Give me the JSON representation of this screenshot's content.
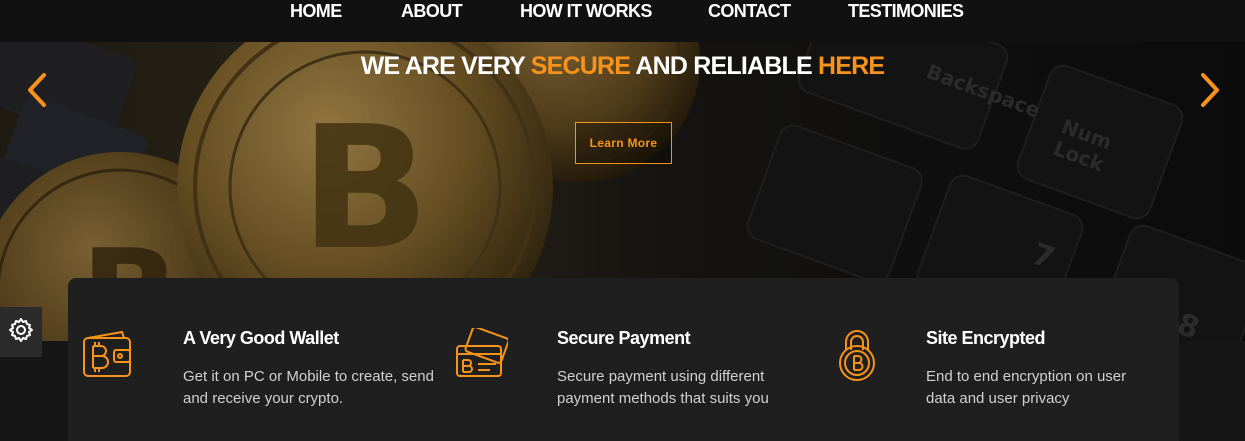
{
  "nav": {
    "items": [
      {
        "label": "HOME"
      },
      {
        "label": "ABOUT"
      },
      {
        "label": "HOW IT WORKS"
      },
      {
        "label": "CONTACT"
      },
      {
        "label": "TESTIMONIES"
      }
    ]
  },
  "hero": {
    "title_part1": "WE ARE VERY ",
    "title_accent1": "SECURE",
    "title_part2": " AND RELIABLE ",
    "title_accent2": "HERE",
    "button_label": "Learn More",
    "prev_icon": "chevron-left-icon",
    "next_icon": "chevron-right-icon",
    "background_image": "bitcoin coins on keyboard"
  },
  "features": [
    {
      "icon": "bitcoin-wallet-icon",
      "title": "A Very Good Wallet",
      "desc_line1": "Get it on PC or Mobile to create, send",
      "desc_line2": "and receive your crypto."
    },
    {
      "icon": "bitcoin-card-icon",
      "title": "Secure Payment",
      "desc_line1": "Secure payment using different",
      "desc_line2": "payment methods that suits you"
    },
    {
      "icon": "bitcoin-lock-icon",
      "title": "Site Encrypted",
      "desc_line1": "End to end encryption on user",
      "desc_line2": "data and user privacy"
    }
  ],
  "settings": {
    "icon": "gear-icon"
  },
  "colors": {
    "accent": "#f7931a",
    "navbar": "#111111",
    "card": "#1f1f1f",
    "page": "#161616"
  }
}
